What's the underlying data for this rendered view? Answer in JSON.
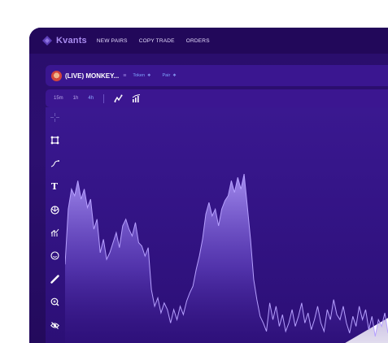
{
  "app": {
    "logo_text": "Kvants"
  },
  "nav": {
    "items": [
      "NEW PAIRS",
      "COPY TRADE",
      "ORDERS"
    ]
  },
  "token": {
    "title": "(LIVE) MONKEY...",
    "token_label": "Token",
    "pair_label": "Pair"
  },
  "intervals": {
    "items": [
      "15m",
      "1h",
      "4h"
    ],
    "active": "4h"
  },
  "sidebar_tools": [
    "crosshair-icon",
    "connect-icon",
    "trendline-icon",
    "text-tool-icon",
    "pattern-icon",
    "measure-icon",
    "emoji-icon",
    "ruler-icon",
    "zoom-icon",
    "hide-icon"
  ],
  "sidebar_text_tool": "T",
  "colors": {
    "accent": "#8ea7ff",
    "background": "#2c0f70",
    "area_fill_top": "#a58bf0",
    "line": "#b6a0ff"
  },
  "chart_data": {
    "type": "area",
    "values": [
      0.45,
      0.78,
      0.9,
      0.86,
      0.95,
      0.84,
      0.9,
      0.79,
      0.84,
      0.66,
      0.72,
      0.52,
      0.6,
      0.48,
      0.52,
      0.58,
      0.64,
      0.55,
      0.68,
      0.72,
      0.66,
      0.62,
      0.7,
      0.58,
      0.56,
      0.5,
      0.55,
      0.3,
      0.2,
      0.25,
      0.16,
      0.22,
      0.18,
      0.1,
      0.18,
      0.12,
      0.2,
      0.15,
      0.23,
      0.28,
      0.32,
      0.42,
      0.5,
      0.6,
      0.75,
      0.82,
      0.74,
      0.78,
      0.68,
      0.78,
      0.83,
      0.86,
      0.95,
      0.88,
      0.97,
      0.9,
      0.99,
      0.8,
      0.6,
      0.36,
      0.24,
      0.14,
      0.1,
      0.05,
      0.22,
      0.12,
      0.2,
      0.08,
      0.15,
      0.05,
      0.1,
      0.18,
      0.08,
      0.14,
      0.22,
      0.1,
      0.16,
      0.06,
      0.12,
      0.2,
      0.1,
      0.05,
      0.18,
      0.12,
      0.24,
      0.15,
      0.12,
      0.2,
      0.1,
      0.04,
      0.14,
      0.08,
      0.2,
      0.12,
      0.18,
      0.06,
      0.14,
      0.02,
      0.12,
      0.08,
      0.16,
      0.04
    ]
  }
}
